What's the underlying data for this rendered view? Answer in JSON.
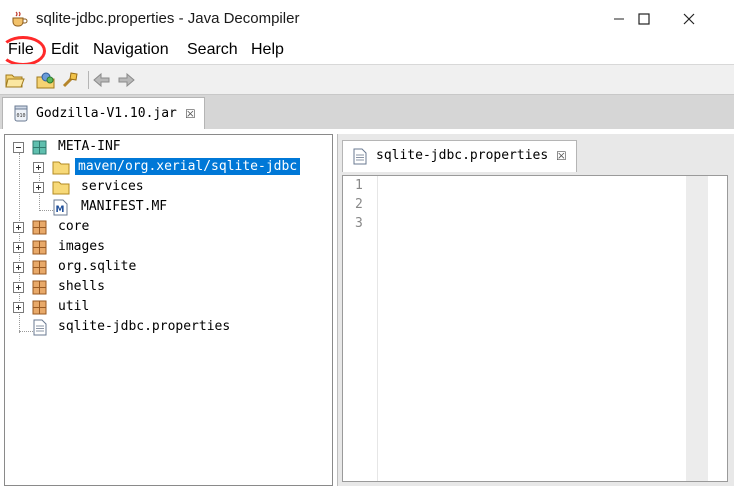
{
  "window": {
    "title": "sqlite-jdbc.properties - Java Decompiler",
    "minimize_icon": "minimize-icon",
    "maximize_icon": "maximize-icon",
    "close_icon": "close-icon"
  },
  "menu": {
    "items": [
      "File",
      "Edit",
      "Navigation",
      "Search",
      "Help"
    ],
    "highlight_color": "#ff2a2a"
  },
  "toolbar": {
    "icons": [
      "open-file-icon",
      "open-type-icon",
      "search-icon",
      "back-arrow-icon",
      "forward-arrow-icon"
    ]
  },
  "outer_tab": {
    "label": "Godzilla-V1.10.jar",
    "icon": "jar-file-icon"
  },
  "tree": {
    "items": [
      {
        "label": "META-INF",
        "icon": "package-icon",
        "expanded": true
      },
      {
        "label": "maven/org.xerial/sqlite-jdbc",
        "icon": "folder-icon",
        "selected": true
      },
      {
        "label": "services",
        "icon": "folder-icon"
      },
      {
        "label": "MANIFEST.MF",
        "icon": "manifest-file-icon"
      },
      {
        "label": "core",
        "icon": "package-icon"
      },
      {
        "label": "images",
        "icon": "package-icon"
      },
      {
        "label": "org.sqlite",
        "icon": "package-icon"
      },
      {
        "label": "shells",
        "icon": "package-icon"
      },
      {
        "label": "util",
        "icon": "package-icon"
      },
      {
        "label": "sqlite-jdbc.properties",
        "icon": "text-file-icon"
      }
    ],
    "selection_color": "#0078d7"
  },
  "editor": {
    "tab_label": "sqlite-jdbc.properties",
    "tab_icon": "text-file-icon",
    "line_numbers": [
      "1",
      "2",
      "3"
    ]
  }
}
